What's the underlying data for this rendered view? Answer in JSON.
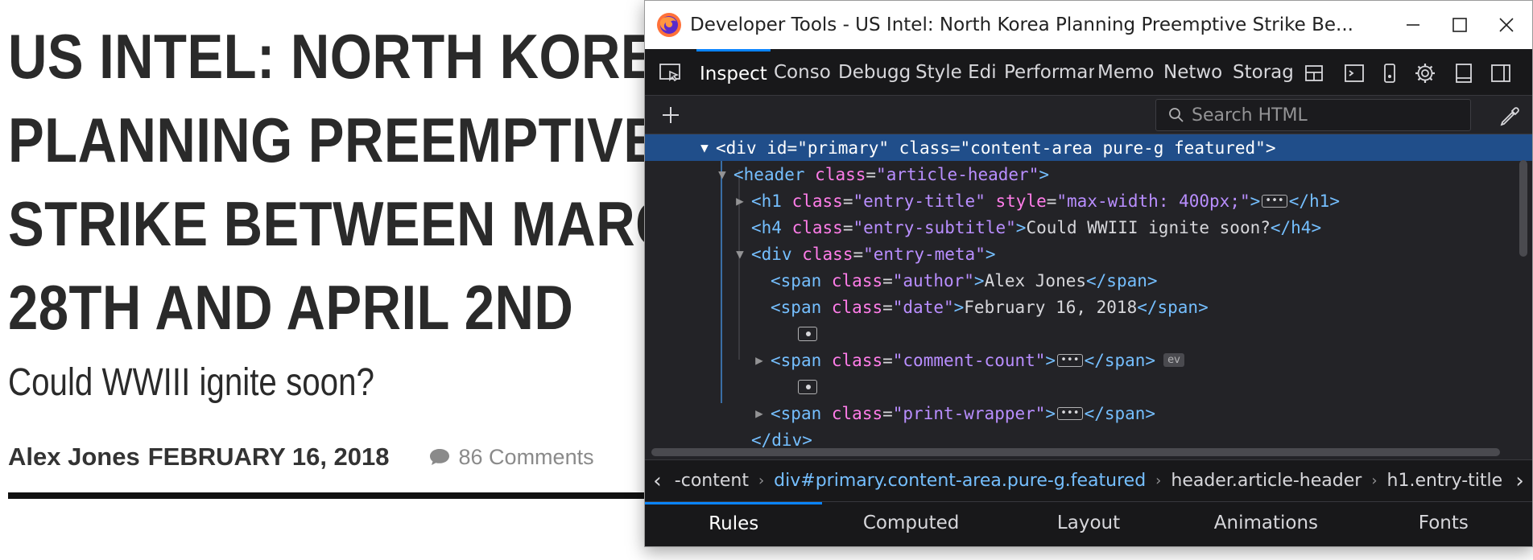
{
  "article": {
    "headline_lines": [
      "US INTEL: NORTH KOREA",
      "PLANNING PREEMPTIVE",
      "STRIKE BETWEEN MARCH",
      "28TH AND APRIL 2ND"
    ],
    "subtitle": "Could WWIII ignite soon?",
    "author": "Alex Jones",
    "date": "FEBRUARY 16, 2018",
    "comments": "86 Comments"
  },
  "devtools": {
    "window_title": "Developer Tools - US Intel: North Korea Planning Preemptive Strike Be...",
    "tabs": [
      "Inspect",
      "Conso",
      "Debugg",
      "Style Edi",
      "Performar",
      "Memo",
      "Netwo",
      "Storag"
    ],
    "search_placeholder": "Search HTML",
    "markup": {
      "l1": {
        "tag": "div",
        "a1": "id",
        "v1": "\"primary\"",
        "a2": "class",
        "v2": "\"content-area pure-g featured\""
      },
      "l2": {
        "tag": "header",
        "a1": "class",
        "v1": "\"article-header\""
      },
      "l3": {
        "tag": "h1",
        "a1": "class",
        "v1": "\"entry-title\"",
        "a2": "style",
        "v2": "\"max-width: 400px;\"",
        "close": "</h1>"
      },
      "l4": {
        "tag": "h4",
        "a1": "class",
        "v1": "\"entry-subtitle\"",
        "text": "Could WWIII ignite soon?",
        "close": "</h4>"
      },
      "l5": {
        "tag": "div",
        "a1": "class",
        "v1": "\"entry-meta\""
      },
      "l6": {
        "tag": "span",
        "a1": "class",
        "v1": "\"author\"",
        "text": "Alex Jones",
        "close": "</span>"
      },
      "l7": {
        "tag": "span",
        "a1": "class",
        "v1": "\"date\"",
        "text": "February 16, 2018",
        "close": "</span>"
      },
      "l9": {
        "tag": "span",
        "a1": "class",
        "v1": "\"comment-count\"",
        "close": "</span>",
        "badge": "ev"
      },
      "l11": {
        "tag": "span",
        "a1": "class",
        "v1": "\"print-wrapper\"",
        "close": "</span>"
      },
      "l12": {
        "close": "</div>"
      }
    },
    "breadcrumbs": [
      "-content",
      "div#primary.content-area.pure-g.featured",
      "header.article-header",
      "h1.entry-title"
    ],
    "side_tabs": [
      "Rules",
      "Computed",
      "Layout",
      "Animations",
      "Fonts"
    ],
    "colors": {
      "accent": "#0a84ff",
      "selection": "#204e8a",
      "tag": "#75bfff",
      "attr": "#ff7de9",
      "value": "#b98eff"
    }
  }
}
